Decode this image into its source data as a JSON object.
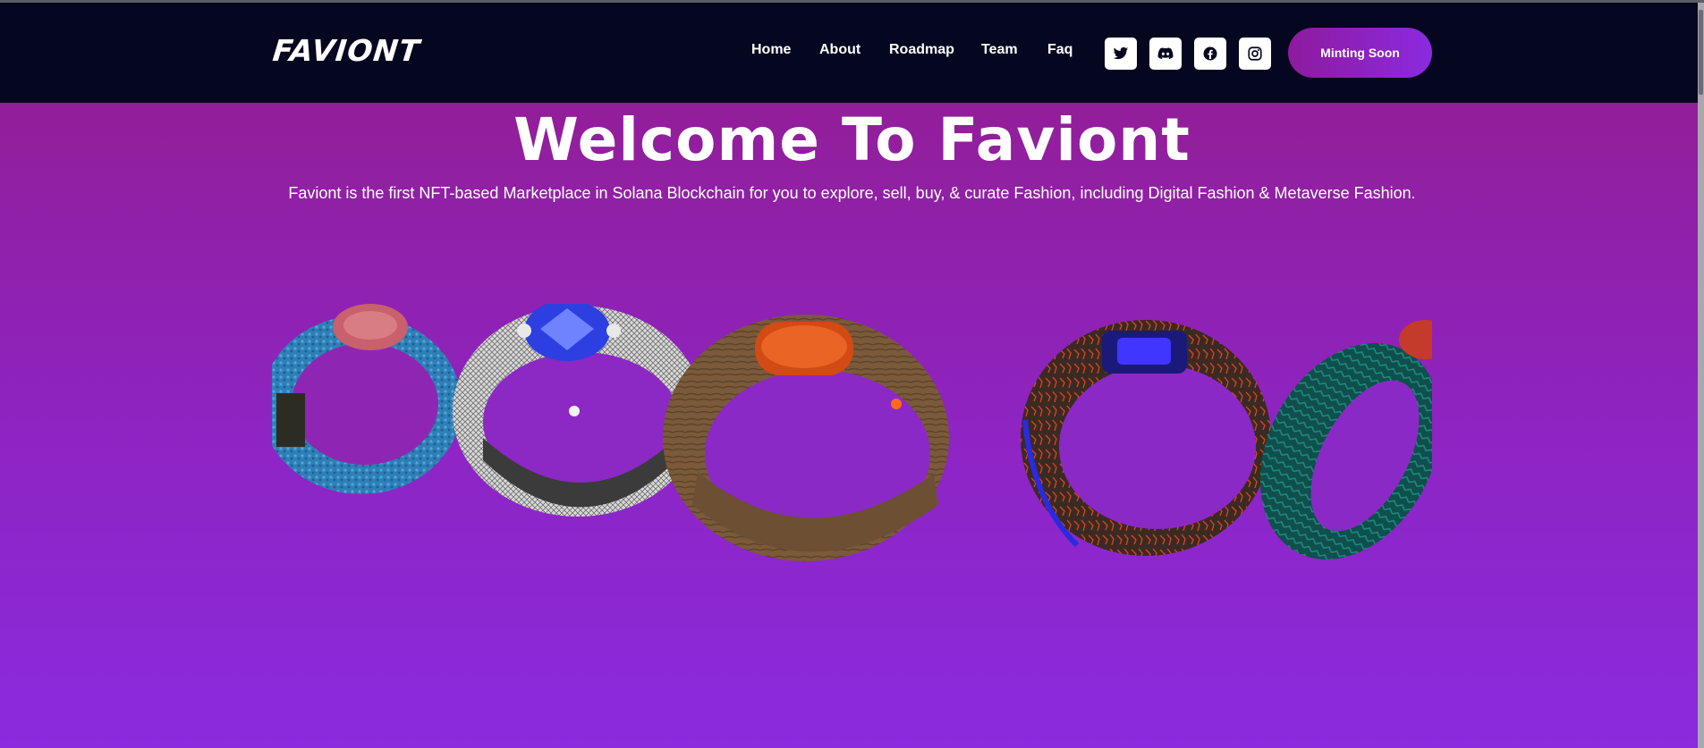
{
  "header": {
    "logo_text": "FAVIONT",
    "nav": [
      "Home",
      "About",
      "Roadmap",
      "Team",
      "Faq"
    ],
    "social_icons": [
      "twitter-icon",
      "discord-icon",
      "facebook-icon",
      "instagram-icon"
    ],
    "cta_label": "Minting Soon"
  },
  "hero": {
    "title": "Welcome To Faviont",
    "subtitle": "Faviont is the first NFT-based Marketplace in Solana Blockchain for you to explore, sell, buy, & curate Fashion, including Digital Fashion & Metaverse Fashion."
  },
  "carousel": {
    "rings": [
      "blue-textured-ring",
      "silver-engraved-ring",
      "wooden-ring-with-orange-gem",
      "lava-ring-with-blue-gem",
      "teal-ring"
    ]
  },
  "colors": {
    "nav_bg": "#05061f",
    "gradient_top": "#931c8c",
    "gradient_bottom": "#8b2ade",
    "accent": "#8e24c0"
  }
}
